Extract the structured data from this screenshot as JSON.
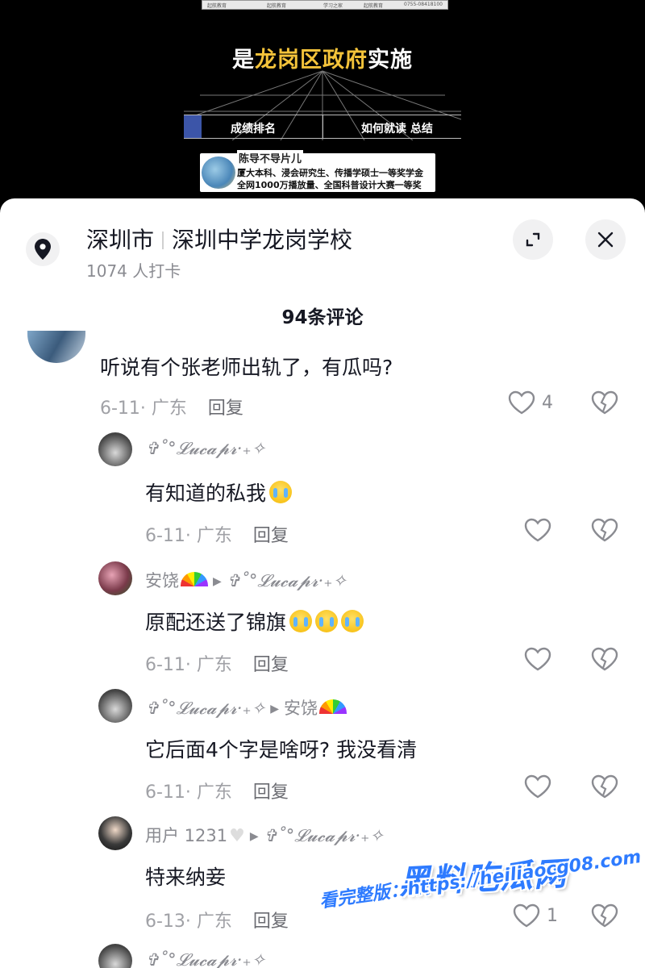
{
  "video": {
    "table_cells": [
      "起航教育",
      "起航教育",
      "学习之家",
      "起航教育",
      "0755-08418100"
    ],
    "headline_pre": "是",
    "headline_highlight": "龙岗区政府",
    "headline_post": "实施",
    "nav_left": "成绩排名",
    "nav_right": "如何就读  总结",
    "ad": {
      "name": "陈导不导片儿",
      "line1": "厦大本科、浸会研究生、传播学硕士一等奖学金",
      "line2": "全网1000万播放量、全国科普设计大赛一等奖"
    }
  },
  "location": {
    "city": "深圳市",
    "place": "深圳中学龙岗学校",
    "checkins": "1074 人打卡",
    "icon": "location-pin-icon"
  },
  "comments_header": "94条评论",
  "comments": [
    {
      "user": "",
      "text": "听说有个张老师出轨了，有瓜吗?",
      "date": "6-11· 广东",
      "reply": "回复",
      "likes": "4"
    },
    {
      "user": "✞˚°𝓛𝓾𝓬𝓪𝓹𝓻·₊✧",
      "text": "有知道的私我",
      "date": "6-11· 广东",
      "reply": "回复",
      "likes": ""
    },
    {
      "user": "安饶",
      "reply_to": "✞˚°𝓛𝓾𝓬𝓪𝓹𝓻·₊✧",
      "text": "原配还送了锦旗",
      "date": "6-11· 广东",
      "reply": "回复",
      "likes": ""
    },
    {
      "user": "✞˚°𝓛𝓾𝓬𝓪𝓹𝓻·₊✧",
      "reply_to": "安饶",
      "text": "它后面4个字是啥呀? 我没看清",
      "date": "6-11· 广东",
      "reply": "回复",
      "likes": ""
    },
    {
      "user": "用户 1231",
      "reply_to": "✞˚°𝓛𝓾𝓬𝓪𝓹𝓻·₊✧",
      "text": "特来纳妾",
      "date": "6-13· 广东",
      "reply": "回复",
      "likes": "1"
    },
    {
      "user": "✞˚°𝓛𝓾𝓬𝓪𝓹𝓻·₊✧"
    }
  ],
  "watermark": {
    "title": "黑料吃瓜网",
    "url": "看完整版：https://heiliaocg08.com"
  },
  "colors": {
    "text_primary": "#161823",
    "text_secondary": "#8a8b91",
    "headline_highlight": "#f4c33a",
    "watermark_blue": "#2e7bff"
  }
}
